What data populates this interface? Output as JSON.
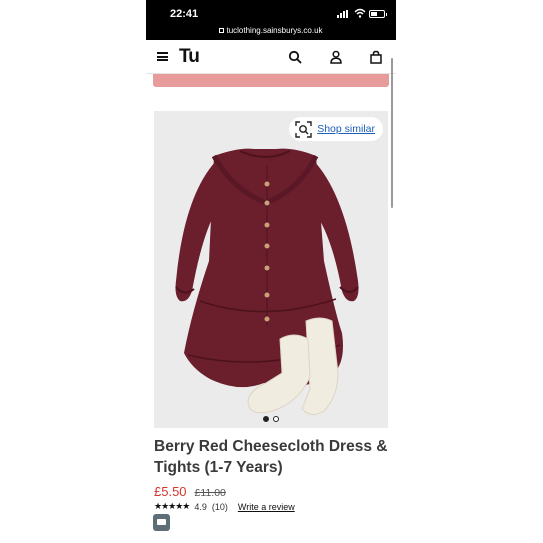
{
  "status_bar": {
    "time": "22:41"
  },
  "browser": {
    "url": "tuclothing.sainsburys.co.uk"
  },
  "header": {
    "logo": "Tu"
  },
  "product": {
    "shop_similar_label": "Shop similar",
    "title": "Berry Red Cheesecloth Dress & Tights (1-7 Years)",
    "price_now": "£5.50",
    "price_was": "£11.00",
    "stars": "★★★★★",
    "rating": "4.9",
    "review_count": "(10)",
    "write_review_label": "Write a review",
    "carousel": {
      "count": 2,
      "active_index": 0
    }
  },
  "colors": {
    "dress": "#6b1e2c",
    "tights": "#f1ece0",
    "price_now": "#d2372c",
    "link": "#1b5fb6",
    "promo_banner": "#e79b9b"
  },
  "icons": [
    "menu-icon",
    "search-icon",
    "account-icon",
    "bag-icon",
    "visual-search-icon",
    "chat-icon",
    "lock-icon"
  ]
}
